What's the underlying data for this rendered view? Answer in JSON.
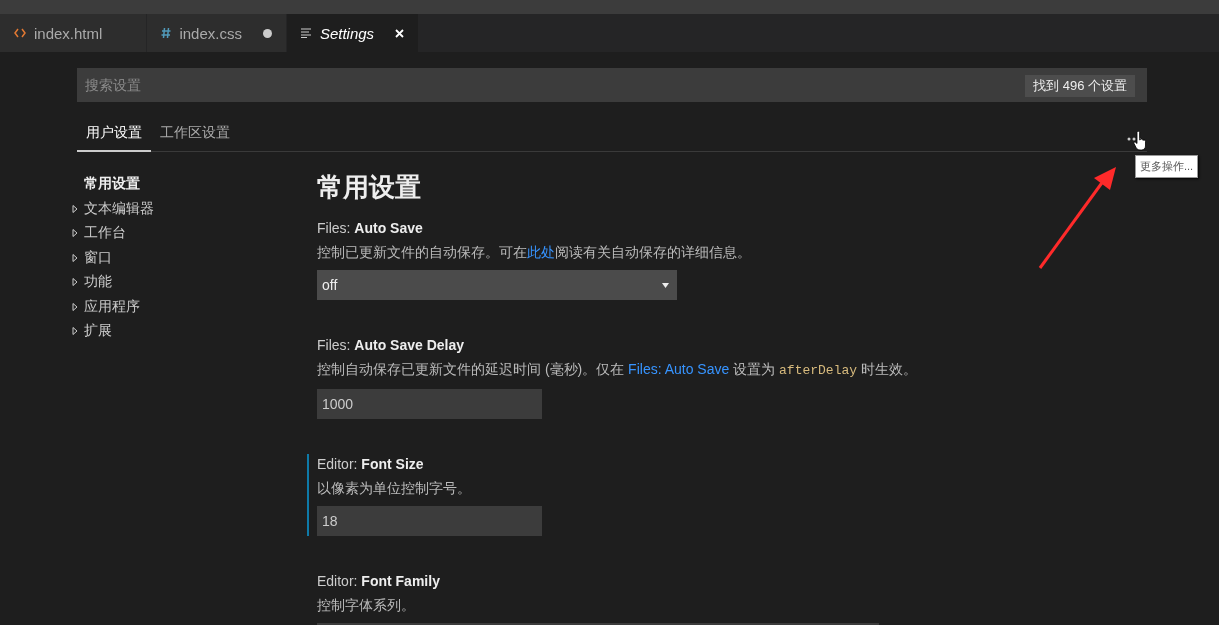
{
  "editor_tabs": [
    {
      "label": "index.html",
      "kind": "html",
      "selected": false,
      "dirty": false,
      "preview": false
    },
    {
      "label": "index.css",
      "kind": "css",
      "selected": false,
      "dirty": true,
      "preview": false
    },
    {
      "label": "Settings",
      "kind": "settings",
      "selected": true,
      "dirty": false,
      "preview": true
    }
  ],
  "search": {
    "placeholder": "搜索设置",
    "result_count": "找到 496 个设置"
  },
  "scope_tabs": [
    {
      "label": "用户设置",
      "selected": true
    },
    {
      "label": "工作区设置",
      "selected": false
    }
  ],
  "more_actions": {
    "tooltip": "更多操作..."
  },
  "toc": [
    {
      "label": "常用设置",
      "kind": "heading"
    },
    {
      "label": "文本编辑器",
      "kind": "group",
      "expanded": false
    },
    {
      "label": "工作台",
      "kind": "group",
      "expanded": false
    },
    {
      "label": "窗口",
      "kind": "group",
      "expanded": false
    },
    {
      "label": "功能",
      "kind": "group",
      "expanded": false
    },
    {
      "label": "应用程序",
      "kind": "group",
      "expanded": false
    },
    {
      "label": "扩展",
      "kind": "group",
      "expanded": false
    }
  ],
  "section_title": "常用设置",
  "settings": [
    {
      "category": "Files: ",
      "name": "Auto Save",
      "focused": false,
      "description": [
        {
          "kind": "text",
          "text": "控制已更新文件的自动保存。可在"
        },
        {
          "kind": "link",
          "text": "此处"
        },
        {
          "kind": "text",
          "text": "阅读有关自动保存的详细信息。"
        }
      ],
      "control": {
        "kind": "select",
        "value": "off"
      }
    },
    {
      "category": "Files: ",
      "name": "Auto Save Delay",
      "focused": false,
      "description": [
        {
          "kind": "text",
          "text": "控制自动保存已更新文件的延迟时间 (毫秒)。仅在 "
        },
        {
          "kind": "link",
          "text": "Files: Auto Save"
        },
        {
          "kind": "text",
          "text": " 设置为 "
        },
        {
          "kind": "code",
          "text": "afterDelay"
        },
        {
          "kind": "text",
          "text": " 时生效。"
        }
      ],
      "control": {
        "kind": "input",
        "value": "1000"
      }
    },
    {
      "category": "Editor: ",
      "name": "Font Size",
      "focused": true,
      "description": [
        {
          "kind": "text",
          "text": "以像素为单位控制字号。"
        }
      ],
      "control": {
        "kind": "input",
        "value": "18"
      }
    },
    {
      "category": "Editor: ",
      "name": "Font Family",
      "focused": false,
      "description": [
        {
          "kind": "text",
          "text": "控制字体系列。"
        }
      ],
      "control": {
        "kind": "wide-input"
      }
    }
  ]
}
